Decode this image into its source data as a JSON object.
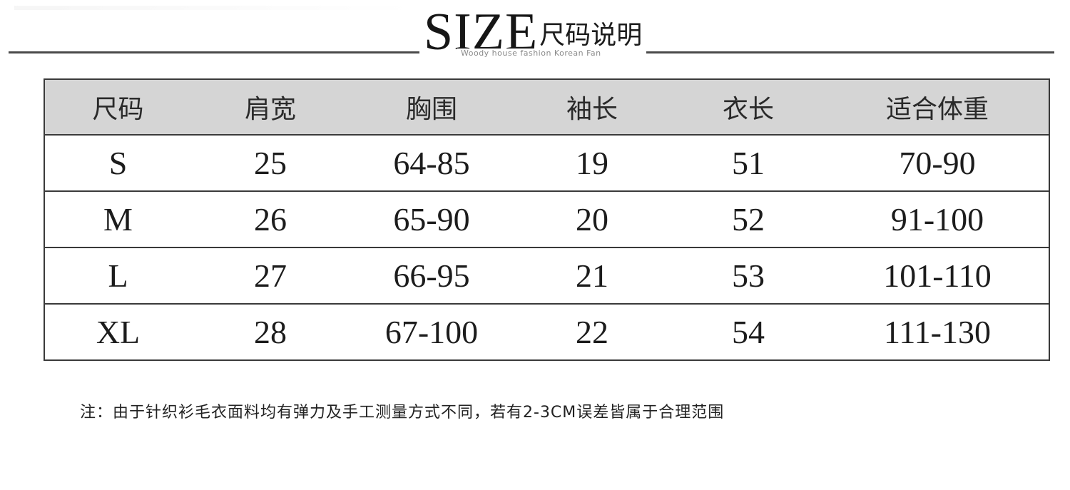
{
  "title": {
    "size_word": "SIZE",
    "cn_word": "尺码说明",
    "subtitle": "Woody house fashion Korean Fan"
  },
  "table": {
    "headers": [
      "尺码",
      "肩宽",
      "胸围",
      "袖长",
      "衣长",
      "适合体重"
    ],
    "rows": [
      [
        "S",
        "25",
        "64-85",
        "19",
        "51",
        "70-90"
      ],
      [
        "M",
        "26",
        "65-90",
        "20",
        "52",
        "91-100"
      ],
      [
        "L",
        "27",
        "66-95",
        "21",
        "53",
        "101-110"
      ],
      [
        "XL",
        "28",
        "67-100",
        "22",
        "54",
        "111-130"
      ]
    ]
  },
  "note": "注：由于针织衫毛衣面料均有弹力及手工测量方式不同，若有2-3CM误差皆属于合理范围",
  "colors": {
    "header_bg": "#d5d5d5",
    "border": "#3a3a3a",
    "rule": "#4a4a4a"
  }
}
